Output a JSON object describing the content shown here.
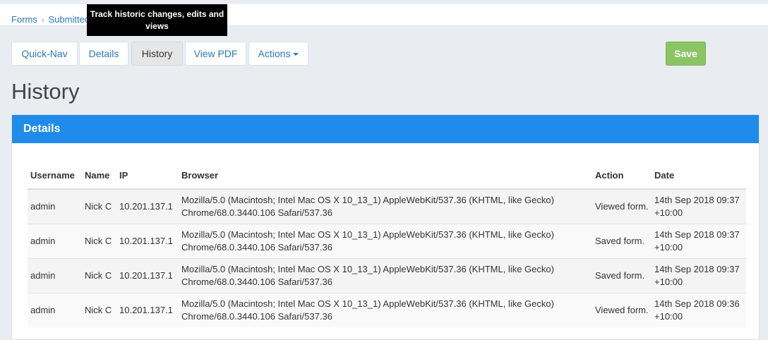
{
  "breadcrumb": {
    "items": [
      "Forms",
      "Submitted"
    ]
  },
  "tooltip": "Track historic changes, edits and views",
  "tabs": [
    {
      "label": "Quick-Nav"
    },
    {
      "label": "Details"
    },
    {
      "label": "History"
    },
    {
      "label": "View PDF"
    },
    {
      "label": "Actions"
    }
  ],
  "save_label": "Save",
  "page_title": "History",
  "panel_title": "Details",
  "table": {
    "headers": [
      "Username",
      "Name",
      "IP",
      "Browser",
      "Action",
      "Date"
    ],
    "rows": [
      {
        "username": "admin",
        "name": "Nick C",
        "ip": "10.201.137.1",
        "browser_line1": "Mozilla/5.0 (Macintosh; Intel Mac OS X 10_13_1) AppleWebKit/537.36 (KHTML, like Gecko)",
        "browser_line2": "Chrome/68.0.3440.106 Safari/537.36",
        "action": "Viewed form.",
        "date": "14th Sep 2018 09:37 +10:00"
      },
      {
        "username": "admin",
        "name": "Nick C",
        "ip": "10.201.137.1",
        "browser_line1": "Mozilla/5.0 (Macintosh; Intel Mac OS X 10_13_1) AppleWebKit/537.36 (KHTML, like Gecko)",
        "browser_line2": "Chrome/68.0.3440.106 Safari/537.36",
        "action": "Saved form.",
        "date": "14th Sep 2018 09:37 +10:00"
      },
      {
        "username": "admin",
        "name": "Nick C",
        "ip": "10.201.137.1",
        "browser_line1": "Mozilla/5.0 (Macintosh; Intel Mac OS X 10_13_1) AppleWebKit/537.36 (KHTML, like Gecko)",
        "browser_line2": "Chrome/68.0.3440.106 Safari/537.36",
        "action": "Saved form.",
        "date": "14th Sep 2018 09:37 +10:00"
      },
      {
        "username": "admin",
        "name": "Nick C",
        "ip": "10.201.137.1",
        "browser_line1": "Mozilla/5.0 (Macintosh; Intel Mac OS X 10_13_1) AppleWebKit/537.36 (KHTML, like Gecko)",
        "browser_line2": "Chrome/68.0.3440.106 Safari/537.36",
        "action": "Viewed form.",
        "date": "14th Sep 2018 09:36 +10:00"
      }
    ]
  },
  "colors": {
    "panel_header": "#1f8ceb",
    "save_button": "#8bc462",
    "link": "#2a7ab8"
  }
}
